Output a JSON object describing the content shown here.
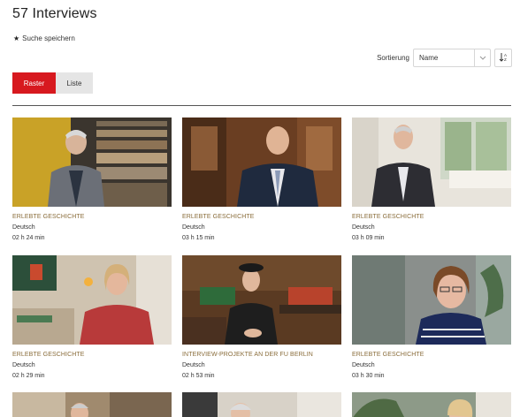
{
  "header": {
    "title": "57 Interviews"
  },
  "save_search": {
    "icon": "star-icon",
    "label": "Suche speichern"
  },
  "sort": {
    "label": "Sortierung",
    "selected": "Name",
    "direction_icon": "sort-az-icon"
  },
  "view_toggle": {
    "raster": "Raster",
    "liste": "Liste",
    "active": "Raster"
  },
  "colors": {
    "accent": "#d7191f",
    "category": "#8a6d3b",
    "inactive_bg": "#e5e5e5"
  },
  "cards": [
    {
      "category": "ERLEBTE GESCHICHTE",
      "language": "Deutsch",
      "duration": "02 h 24 min"
    },
    {
      "category": "ERLEBTE GESCHICHTE",
      "language": "Deutsch",
      "duration": "03 h 15 min"
    },
    {
      "category": "ERLEBTE GESCHICHTE",
      "language": "Deutsch",
      "duration": "03 h 09 min"
    },
    {
      "category": "ERLEBTE GESCHICHTE",
      "language": "Deutsch",
      "duration": "02 h 29 min"
    },
    {
      "category": "INTERVIEW-PROJEKTE AN DER FU BERLIN",
      "language": "Deutsch",
      "duration": "02 h 53 min"
    },
    {
      "category": "ERLEBTE GESCHICHTE",
      "language": "Deutsch",
      "duration": "03 h 30 min"
    }
  ]
}
